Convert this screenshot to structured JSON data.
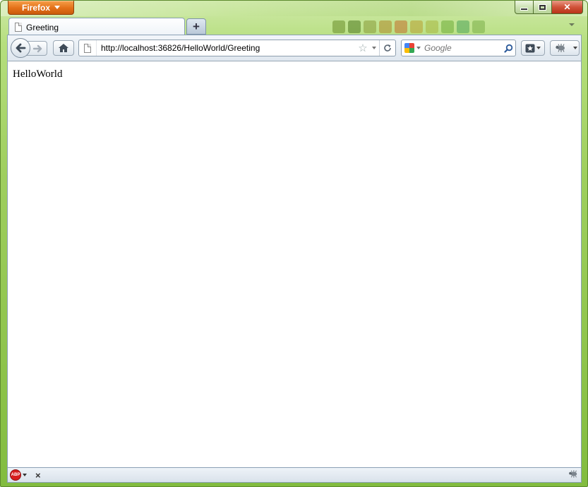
{
  "window": {
    "firefox_menu_label": "Firefox",
    "controls": {
      "minimize": "minimize",
      "maximize": "maximize",
      "close": "close"
    }
  },
  "tabs": [
    {
      "label": "Greeting",
      "icon": "page-icon",
      "active": true
    }
  ],
  "new_tab_label": "+",
  "nav": {
    "url": "http://localhost:36826/HelloWorld/Greeting",
    "search_placeholder": "Google",
    "search_engine": "google-icon"
  },
  "page": {
    "body_text": "HelloWorld"
  },
  "statusbar": {
    "abp_label": "ABP",
    "close_glyph": "×"
  },
  "colors": {
    "window_frame": "#9fcf5f",
    "firefox_button": "#e37018",
    "close_button": "#d0533a"
  }
}
